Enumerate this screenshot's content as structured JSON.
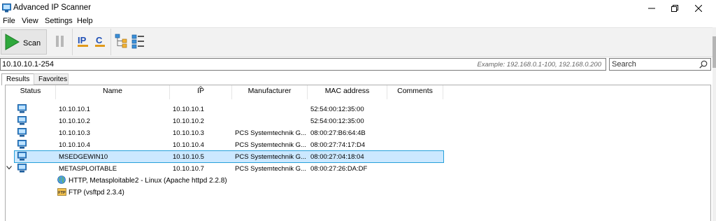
{
  "window": {
    "title": "Advanced IP Scanner"
  },
  "menu": [
    {
      "label": "File"
    },
    {
      "label": "View"
    },
    {
      "label": "Settings"
    },
    {
      "label": "Help"
    }
  ],
  "toolbar": {
    "scan_label": "Scan"
  },
  "address": {
    "value": "10.10.10.1-254",
    "example": "Example: 192.168.0.1-100, 192.168.0.200"
  },
  "search": {
    "placeholder": "Search"
  },
  "tabs": [
    {
      "label": "Results"
    },
    {
      "label": "Favorites"
    }
  ],
  "columns": [
    "Status",
    "Name",
    "IP",
    "Manufacturer",
    "MAC address",
    "Comments"
  ],
  "rows": [
    {
      "name": "10.10.10.1",
      "ip": "10.10.10.1",
      "manufacturer": "",
      "mac": "52:54:00:12:35:00",
      "selected": false
    },
    {
      "name": "10.10.10.2",
      "ip": "10.10.10.2",
      "manufacturer": "",
      "mac": "52:54:00:12:35:00",
      "selected": false
    },
    {
      "name": "10.10.10.3",
      "ip": "10.10.10.3",
      "manufacturer": "PCS Systemtechnik G...",
      "mac": "08:00:27:B6:64:4B",
      "selected": false
    },
    {
      "name": "10.10.10.4",
      "ip": "10.10.10.4",
      "manufacturer": "PCS Systemtechnik G...",
      "mac": "08:00:27:74:17:D4",
      "selected": false
    },
    {
      "name": "MSEDGEWIN10",
      "ip": "10.10.10.5",
      "manufacturer": "PCS Systemtechnik G...",
      "mac": "08:00:27:04:18:04",
      "selected": true
    },
    {
      "name": "METASPLOITABLE",
      "ip": "10.10.10.7",
      "manufacturer": "PCS Systemtechnik G...",
      "mac": "08:00:27:26:DA:DF",
      "selected": false,
      "expanded": true
    }
  ],
  "services": [
    {
      "label": "HTTP, Metasploitable2 - Linux (Apache httpd 2.2.8)",
      "icon": "globe-icon"
    },
    {
      "label": "FTP (vsftpd 2.3.4)",
      "icon": "ftp-icon"
    }
  ]
}
